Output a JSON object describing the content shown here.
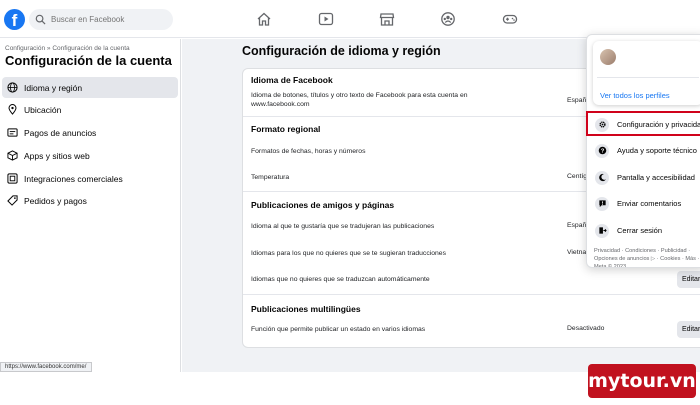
{
  "search": {
    "placeholder": "Buscar en Facebook"
  },
  "nav_icons": [
    "home-icon",
    "video-icon",
    "marketplace-icon",
    "groups-icon",
    "gaming-icon"
  ],
  "sidebar": {
    "breadcrumb": "Configuración » Configuración de la cuenta",
    "title": "Configuración de la cuenta",
    "items": [
      {
        "label": "Idioma y región",
        "icon": "globe-icon",
        "active": true
      },
      {
        "label": "Ubicación",
        "icon": "location-icon",
        "active": false
      },
      {
        "label": "Pagos de anuncios",
        "icon": "ads-payments-icon",
        "active": false
      },
      {
        "label": "Apps y sitios web",
        "icon": "apps-icon",
        "active": false
      },
      {
        "label": "Integraciones comerciales",
        "icon": "business-integrations-icon",
        "active": false
      },
      {
        "label": "Pedidos y pagos",
        "icon": "tag-icon",
        "active": false
      }
    ]
  },
  "main": {
    "title": "Configuración de idioma y región",
    "sections": {
      "facebook_language": {
        "title": "Idioma de Facebook",
        "row1_text": "Idioma de botones, títulos y otro texto de Facebook para esta cuenta en www.facebook.com",
        "row1_value": "Español"
      },
      "regional_format": {
        "title": "Formato regional",
        "row1_text": "Formatos de fechas, horas y números",
        "row2_text": "Temperatura",
        "row2_value": "Centígrados"
      },
      "friends_pages": {
        "title": "Publicaciones de amigos y páginas",
        "row1_text": "Idioma al que te gustaría que se tradujeran las publicaciones",
        "row1_value": "Español",
        "row2_text": "Idiomas para los que no quieres que se te sugieran traducciones",
        "row2_value": "Vietnamita",
        "row3_text": "Idiomas que no quieres que se traduzcan automáticamente",
        "row3_button": "Editar"
      },
      "multilingual": {
        "title": "Publicaciones multilingües",
        "row1_text": "Función que permite publicar un estado en varios idiomas",
        "row1_value": "Desactivado",
        "row1_button": "Editar"
      }
    }
  },
  "dropdown": {
    "see_profiles": "Ver todos los perfiles",
    "items": [
      {
        "label": "Configuración y privacidad",
        "icon": "gear-icon"
      },
      {
        "label": "Ayuda y soporte técnico",
        "icon": "help-icon"
      },
      {
        "label": "Pantalla y accesibilidad",
        "icon": "moon-icon"
      },
      {
        "label": "Enviar comentarios",
        "icon": "feedback-icon"
      },
      {
        "label": "Cerrar sesión",
        "icon": "logout-icon"
      }
    ],
    "footer": "Privacidad · Condiciones · Publicidad · Opciones de anuncios ▷ · Cookies · Más · Meta © 2023",
    "highlight_color": "#d0021b"
  },
  "status_bar": {
    "url": "https://www.facebook.com/me/"
  },
  "watermark": {
    "text": "mytour.vn",
    "color": "#c1121f"
  },
  "colors": {
    "brand": "#1877f2",
    "background": "#f0f2f5"
  }
}
